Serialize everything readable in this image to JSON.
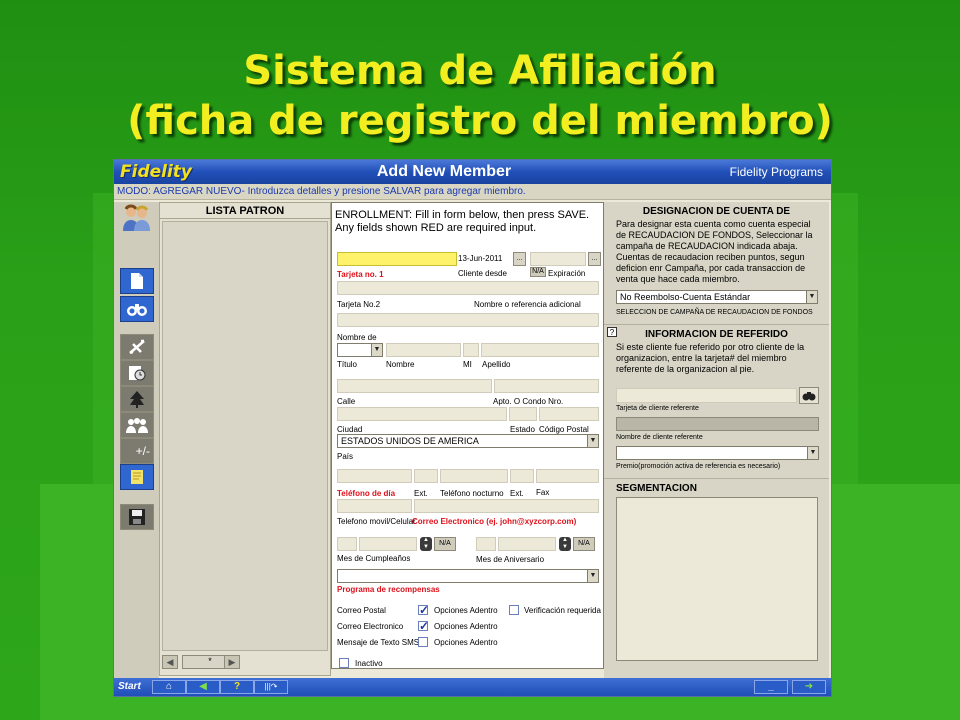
{
  "slide": {
    "title_line1": "Sistema de Afiliación",
    "title_line2": "(ficha de registro del miembro)"
  },
  "window": {
    "logo": "Fidelity",
    "title": "Add New Member",
    "right_label": "Fidelity Programs",
    "mode_text": "MODO: AGREGAR NUEVO- Introduzca detalles y presione SALVAR para agregar miembro."
  },
  "left_toolbar": {
    "icons": [
      "members-icon",
      "new-document-icon",
      "binoculars-icon",
      "airplane-icon",
      "clock-icon",
      "tree-icon",
      "group-icon",
      "points-adjust-icon",
      "note-icon",
      "save-icon"
    ],
    "points_label": "+/-"
  },
  "patron_panel": {
    "header": "LISTA PATRON",
    "nav_mid": "*"
  },
  "form": {
    "instructions": "ENROLLMENT: Fill in form below, then press SAVE. Any fields shown RED are required input.",
    "date_value": "13-Jun-2011",
    "ellipsis": "...",
    "na": "N/A",
    "tarjeta1": "Tarjeta no. 1",
    "cliente_desde": "Cliente desde",
    "expiracion": "Expiración",
    "tarjeta2": "Tarjeta No.2",
    "nombre_ref": "Nombre o referencia adicional",
    "nombre_de": "Nombre de",
    "titulo": "Título",
    "nombre": "Nombre",
    "mi": "MI",
    "apellido": "Apellido",
    "calle": "Calle",
    "apto": "Apto. O Condo Nro.",
    "ciudad": "Ciudad",
    "estado": "Estado",
    "codigo_postal": "Código Postal",
    "pais_value": "ESTADOS UNIDOS DE AMERICA",
    "pais": "País",
    "tel_dia": "Teléfono de día",
    "ext": "Ext.",
    "tel_noche": "Teléfono nocturno",
    "fax": "Fax",
    "movil": "Telefono movil/Celular",
    "correo": "Correo Electronico (ej. john@xyzcorp.com)",
    "mes_cumple": "Mes de Cumpleaños",
    "mes_aniv": "Mes de Aniversario",
    "programa": "Programa de recompensas",
    "correo_postal": "Correo Postal",
    "correo_elec": "Correo Electronico",
    "mensaje_sms": "Mensaje de Texto SMS",
    "opciones": "Opciones Adentro",
    "verificacion": "Verificación requerida",
    "inactivo": "Inactivo",
    "check_mark": "✓"
  },
  "right_panel": {
    "designacion_head": "DESIGNACION DE CUENTA DE",
    "designacion_text": "Para designar esta cuenta como cuenta especial de RECAUDACION DE FONDOS, Seleccionar la campaña de RECAUDACION indicada abaja. Cuentas de recaudacion reciben puntos, segun deficion enr Campaña, por cada transaccion de venta que hace cada  miembro.",
    "cuenta_value": "No Reembolso-Cuenta Estándar",
    "seleccion_label": "SELECCION DE CAMPAÑA DE RECAUDACION DE FONDOS",
    "help": "?",
    "referido_head": "INFORMACION DE REFERIDO",
    "referido_text": "Si este cliente fue referido por otro cliente de la organizacion, entre la tarjeta# del miembro referente de la organizacion al pie.",
    "tarjeta_ref": "Tarjeta de cliente  referente",
    "nombre_ref": "Nombre de cliente referente",
    "premio": "Premio(promoción activa de referencia es necesario)",
    "segmentacion_head": "SEGMENTACION"
  },
  "statusbar": {
    "start": "Start",
    "minimize": "_"
  },
  "colors": {
    "slide_bg": "#2aa018",
    "title_yellow": "#f3ee20",
    "titlebar_blue": "#2150b8",
    "required_red": "#e0101a",
    "highlight_yellow": "#fdf26a"
  }
}
